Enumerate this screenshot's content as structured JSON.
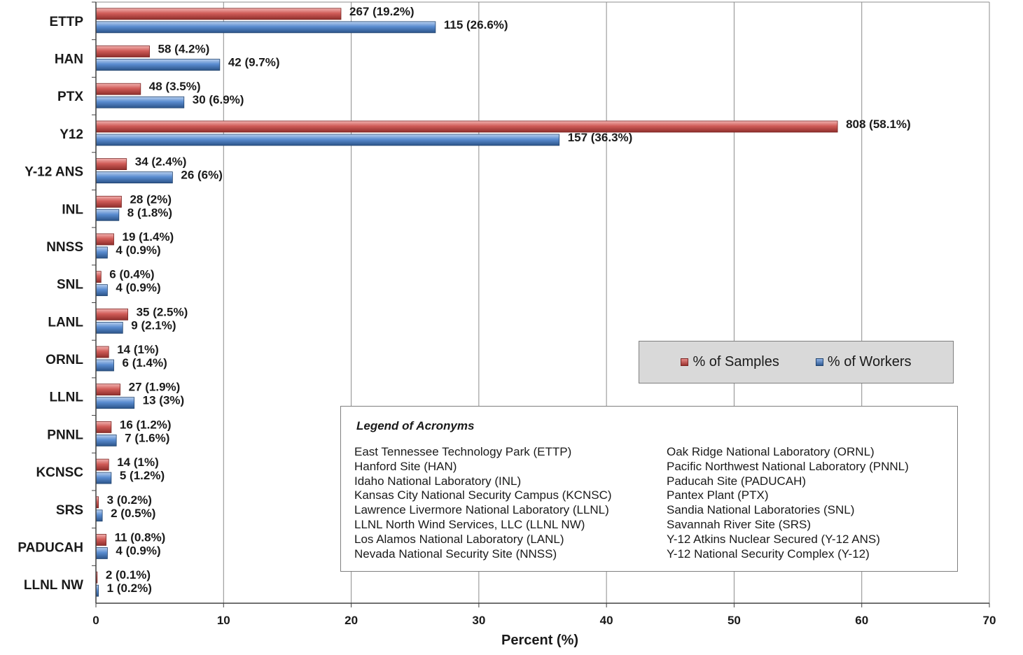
{
  "chart_data": {
    "type": "bar",
    "orientation": "horizontal",
    "categories": [
      "ETTP",
      "HAN",
      "PTX",
      "Y12",
      "Y-12 ANS",
      "INL",
      "NNSS",
      "SNL",
      "LANL",
      "ORNL",
      "LLNL",
      "PNNL",
      "KCNSC",
      "SRS",
      "PADUCAH",
      "LLNL NW"
    ],
    "series": [
      {
        "name": "% of Samples",
        "color": "#c0504d",
        "values": [
          19.2,
          4.2,
          3.5,
          58.1,
          2.4,
          2.0,
          1.4,
          0.4,
          2.5,
          1.0,
          1.9,
          1.2,
          1.0,
          0.2,
          0.8,
          0.1
        ],
        "labels": [
          "267 (19.2%)",
          "58 (4.2%)",
          "48 (3.5%)",
          "808 (58.1%)",
          "34 (2.4%)",
          "28 (2%)",
          "19 (1.4%)",
          "6 (0.4%)",
          "35 (2.5%)",
          "14 (1%)",
          "27 (1.9%)",
          "16 (1.2%)",
          "14 (1%)",
          "3 (0.2%)",
          "11 (0.8%)",
          "2 (0.1%)"
        ]
      },
      {
        "name": "% of Workers",
        "color": "#4f81bd",
        "values": [
          26.6,
          9.7,
          6.9,
          36.3,
          6.0,
          1.8,
          0.9,
          0.9,
          2.1,
          1.4,
          3.0,
          1.6,
          1.2,
          0.5,
          0.9,
          0.2
        ],
        "labels": [
          "115 (26.6%)",
          "42 (9.7%)",
          "30 (6.9%)",
          "157 (36.3%)",
          "26 (6%)",
          "8 (1.8%)",
          "4 (0.9%)",
          "4 (0.9%)",
          "9 (2.1%)",
          "6 (1.4%)",
          "13 (3%)",
          "7 (1.6%)",
          "5 (1.2%)",
          "2 (0.5%)",
          "4 (0.9%)",
          "1 (0.2%)"
        ]
      }
    ],
    "xlabel": "Percent (%)",
    "xlim": [
      0,
      70
    ],
    "xticks": [
      "0",
      "10",
      "20",
      "30",
      "40",
      "50",
      "60",
      "70"
    ],
    "grid": true,
    "legend_position": "right-middle"
  },
  "legend": {
    "items": [
      {
        "label": "% of Samples",
        "color": "#c0504d"
      },
      {
        "label": "% of Workers",
        "color": "#4f81bd"
      }
    ]
  },
  "acronyms": {
    "title": "Legend of Acronyms",
    "left": [
      "East Tennessee Technology Park (ETTP)",
      "Hanford Site (HAN)",
      "Idaho National Laboratory (INL)",
      "Kansas City National Security Campus (KCNSC)",
      "Lawrence Livermore National Laboratory (LLNL)",
      "LLNL North Wind Services, LLC (LLNL NW)",
      "Los Alamos National Laboratory (LANL)",
      "Nevada National Security Site (NNSS)"
    ],
    "right": [
      "Oak Ridge National Laboratory (ORNL)",
      "Pacific Northwest National Laboratory (PNNL)",
      "Paducah Site (PADUCAH)",
      "Pantex Plant (PTX)",
      "Sandia National Laboratories (SNL)",
      "Savannah River Site (SRS)",
      "Y-12 Atkins Nuclear Secured (Y-12 ANS)",
      "Y-12 National Security Complex (Y-12)"
    ]
  }
}
